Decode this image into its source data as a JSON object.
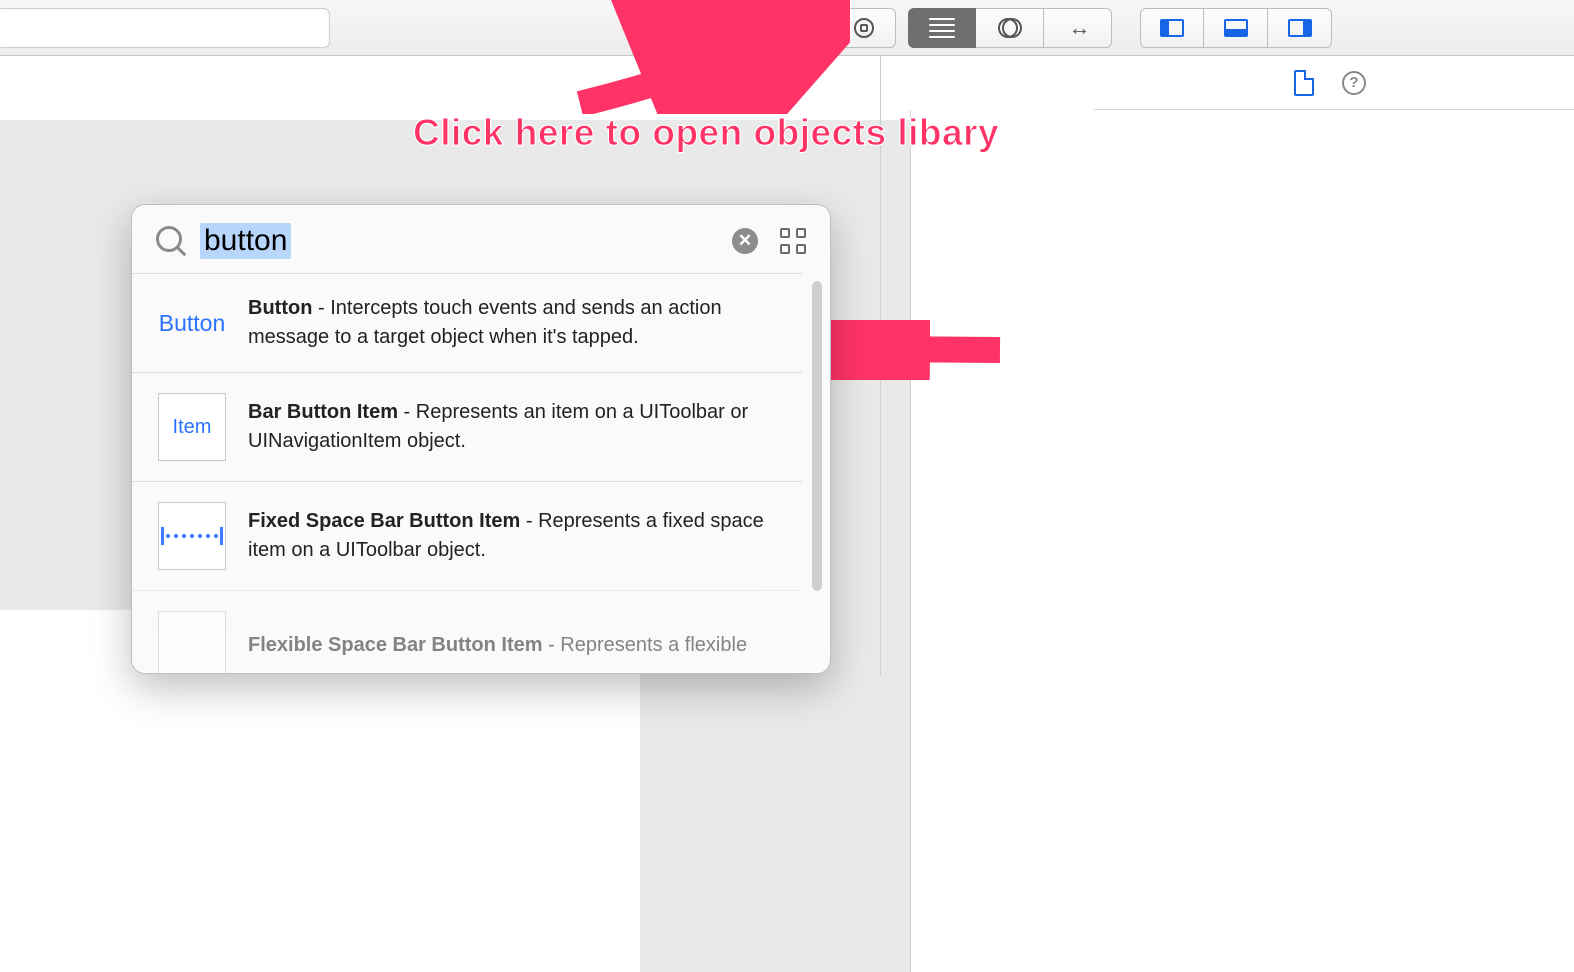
{
  "annotation": {
    "callout_text": "Click here to open objects libary"
  },
  "library": {
    "search_value": "button",
    "results": [
      {
        "thumb_label": "Button",
        "title": "Button",
        "description": "Intercepts touch events and sends an action message to a target object when it's tapped."
      },
      {
        "thumb_label": "Item",
        "title": "Bar Button Item",
        "description": "Represents an item on a UIToolbar or UINavigationItem object."
      },
      {
        "thumb_label": "fixed-space",
        "title": "Fixed Space Bar Button Item",
        "description": "Represents a fixed space item on a UIToolbar object."
      },
      {
        "thumb_label": "flex-space",
        "title": "Flexible Space Bar Button Item",
        "description": "Represents a flexible"
      }
    ]
  }
}
